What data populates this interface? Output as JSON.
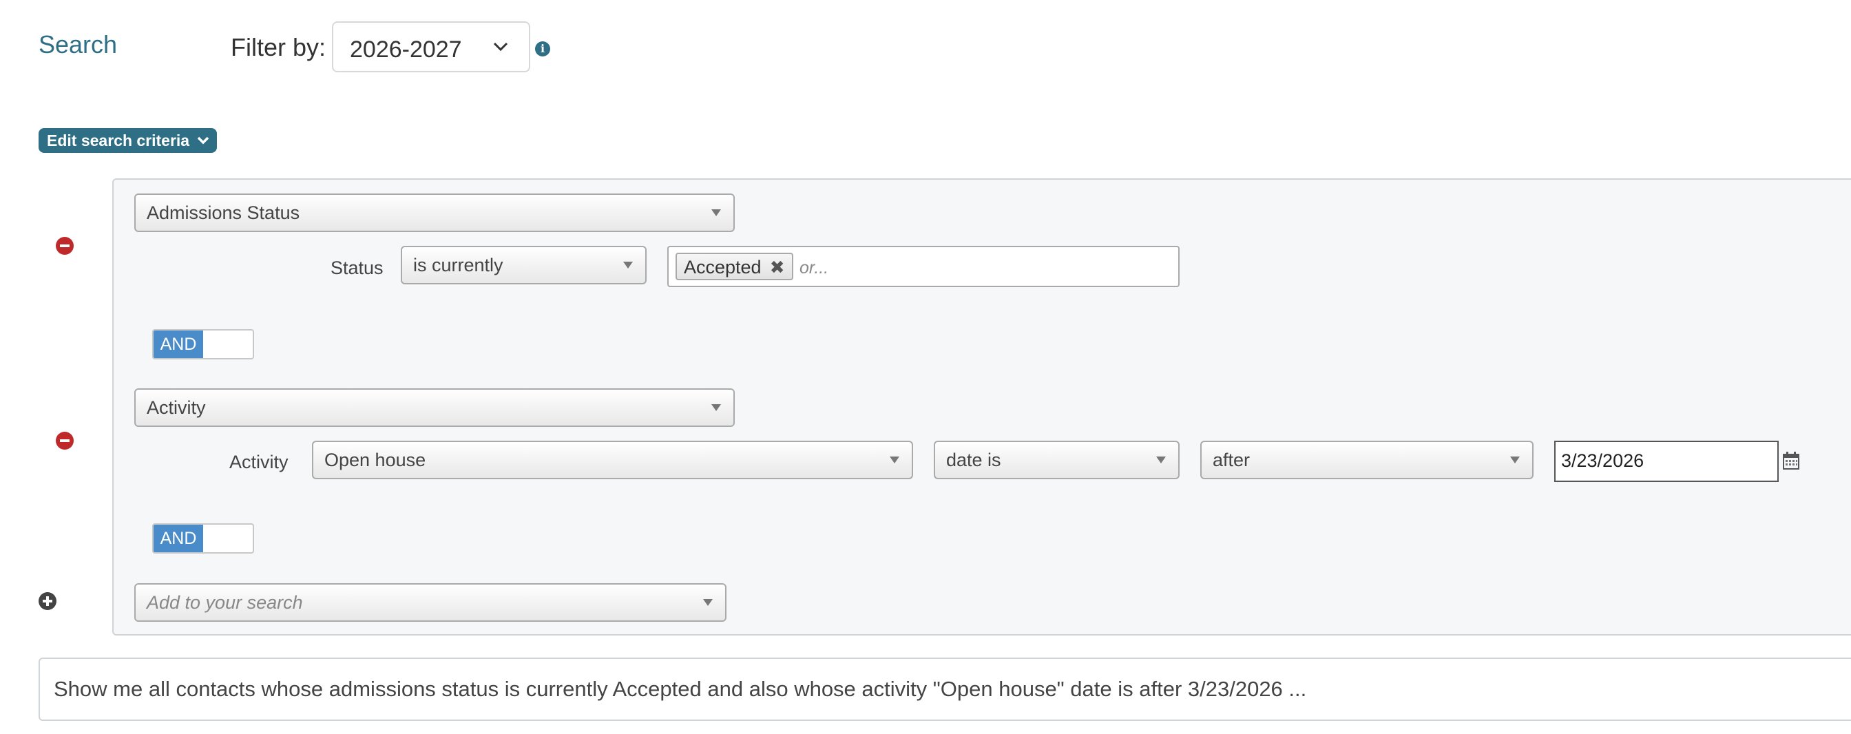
{
  "header": {
    "title": "Search",
    "filter_label": "Filter by:",
    "filter_value": "2026-2027"
  },
  "edit_criteria_label": "Edit search criteria",
  "criteria": [
    {
      "field": "Admissions Status",
      "sub_label": "Status",
      "operator": "is currently",
      "selected_tags": [
        "Accepted"
      ],
      "tag_input_placeholder": "or..."
    },
    {
      "field": "Activity",
      "sub_label": "Activity",
      "activity_value": "Open house",
      "date_operator": "date is",
      "comparison": "after",
      "date_value": "3/23/2026"
    }
  ],
  "connector_label": "AND",
  "add_placeholder": "Add to your search",
  "summary_text": "Show me all contacts whose admissions status is currently Accepted and also whose activity \"Open house\" date is after 3/23/2026 ...",
  "colors": {
    "accent": "#2e6f86",
    "toggle_active": "#4a8cc9",
    "remove": "#c0292a",
    "panel_bg": "#f6f7f8"
  },
  "icons": [
    "chevron-down-icon",
    "info-icon",
    "remove-criterion-icon",
    "tag-remove-icon",
    "dropdown-caret-icon",
    "calendar-icon",
    "add-criterion-icon"
  ]
}
